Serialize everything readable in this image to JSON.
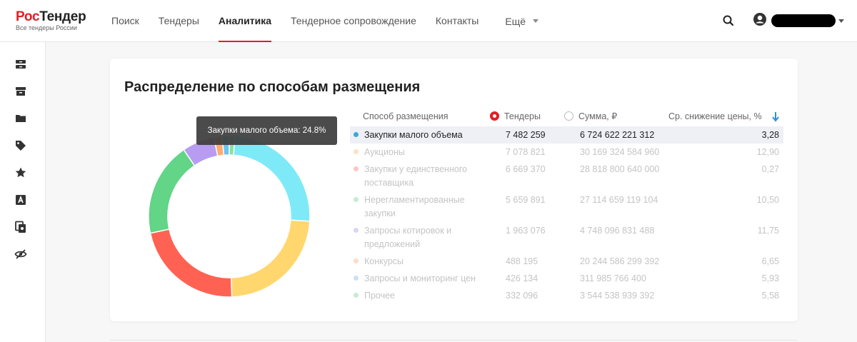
{
  "header": {
    "logo_part1": "Рос",
    "logo_part2": "Тендер",
    "logo_sub": "Все тендеры России",
    "nav": [
      "Поиск",
      "Тендеры",
      "Аналитика",
      "Тендерное сопровождение",
      "Контакты"
    ],
    "nav_active": "Аналитика",
    "more": "Ещё"
  },
  "sidebar_icons": [
    "archive-box-icon",
    "inbox-icon",
    "folder-icon",
    "tag-icon",
    "star-icon",
    "font-a-icon",
    "copy-icon",
    "eye-off-icon"
  ],
  "card": {
    "title": "Распределение по способам размещения",
    "tooltip": "Закупки малого объема: 24.8%",
    "columns": {
      "method": "Способ размещения",
      "tenders": "Тендеры",
      "sum": "Сумма, ₽",
      "drop": "Ср. снижение цены, %"
    },
    "sort_selected": "tenders"
  },
  "chart_data": {
    "type": "pie",
    "title": "Распределение по способам размещения",
    "categories": [
      "Закупки малого объема",
      "Аукционы",
      "Закупки у единственного поставщика",
      "Нерегламентированные закупки",
      "Запросы котировок и предложений",
      "Конкурсы",
      "Запросы и мониторинг цен",
      "Прочее"
    ],
    "values": [
      7482259,
      7078821,
      6669370,
      5659891,
      1963076,
      488195,
      426134,
      332096
    ],
    "colors": [
      "#7eeaf8",
      "#ffd76e",
      "#ff6252",
      "#62d586",
      "#b79cf1",
      "#ffac70",
      "#6ac4f2",
      "#88e3a0"
    ],
    "highlighted": "Закупки малого объема",
    "highlighted_share": "24.8%"
  },
  "rows": [
    {
      "name": "Закупки малого объема",
      "tenders": "7 482 259",
      "sum": "6 724 622 221 312",
      "drop": "3,28",
      "color": "#3aa9d9"
    },
    {
      "name": "Аукционы",
      "tenders": "7 078 821",
      "sum": "30 169 324 584 960",
      "drop": "12,90",
      "color": "#ffe2c4"
    },
    {
      "name": "Закупки у единственного поставщика",
      "tenders": "6 669 370",
      "sum": "28 818 800 640 000",
      "drop": "0,27",
      "color": "#ffc5c5"
    },
    {
      "name": "Нерегламентированные закупки",
      "tenders": "5 659 891",
      "sum": "27 114 659 119 104",
      "drop": "10,50",
      "color": "#c6ecd2"
    },
    {
      "name": "Запросы котировок и предложений",
      "tenders": "1 963 076",
      "sum": "4 748 096 831 488",
      "drop": "11,75",
      "color": "#dcd4f6"
    },
    {
      "name": "Конкурсы",
      "tenders": "488 195",
      "sum": "20 244 586 299 392",
      "drop": "6,65",
      "color": "#ffdcc6"
    },
    {
      "name": "Запросы и мониторинг цен",
      "tenders": "426 134",
      "sum": "311 985 766 400",
      "drop": "5,93",
      "color": "#c8e2f6"
    },
    {
      "name": "Прочее",
      "tenders": "332 096",
      "sum": "3 544 538 939 392",
      "drop": "5,58",
      "color": "#c6ecd2"
    }
  ]
}
